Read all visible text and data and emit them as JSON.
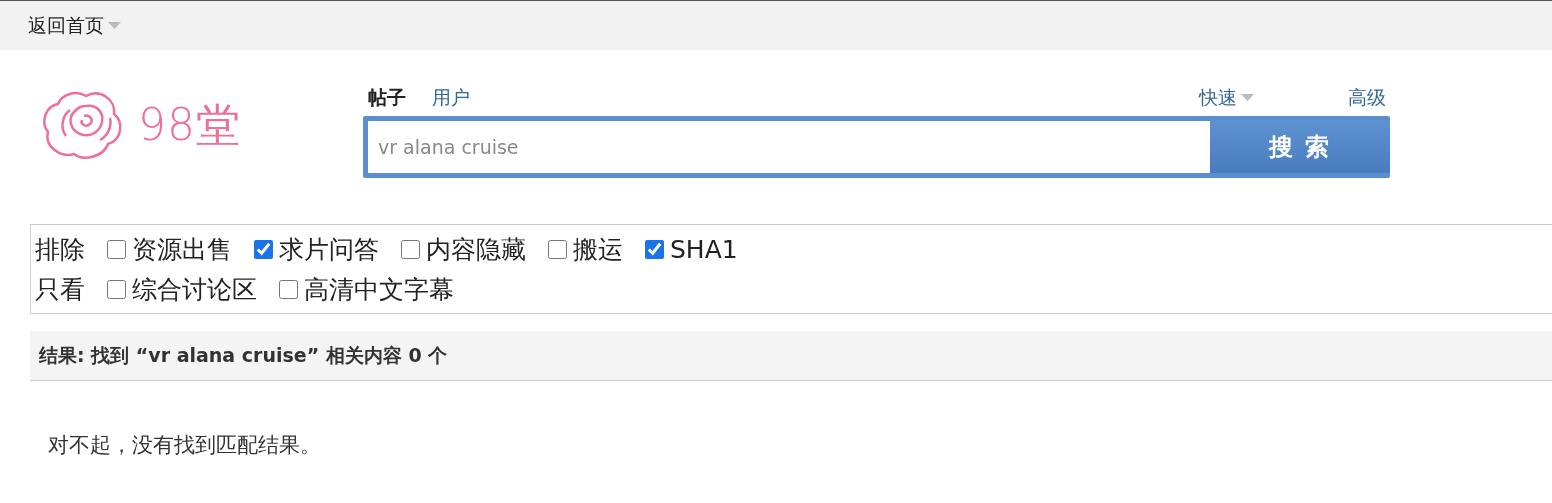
{
  "topbar": {
    "home_link": "返回首页"
  },
  "logo": {
    "text": "98堂"
  },
  "search": {
    "tabs": [
      {
        "label": "帖子",
        "selected": true
      },
      {
        "label": "用户",
        "selected": false
      }
    ],
    "quick": "快速",
    "advanced": "高级",
    "value": "vr alana cruise",
    "button": "搜 索"
  },
  "filters": [
    {
      "label": "排除",
      "options": [
        {
          "label": "资源出售",
          "checked": false
        },
        {
          "label": "求片问答",
          "checked": true
        },
        {
          "label": "内容隐藏",
          "checked": false
        },
        {
          "label": "搬运",
          "checked": false
        },
        {
          "label": "SHA1",
          "checked": true
        }
      ]
    },
    {
      "label": "只看",
      "options": [
        {
          "label": "综合讨论区",
          "checked": false
        },
        {
          "label": "高清中文字幕",
          "checked": false
        }
      ]
    }
  ],
  "result": {
    "heading": "结果: 找到 “vr alana cruise” 相关内容 0 个",
    "message": "对不起，没有找到匹配结果。"
  }
}
